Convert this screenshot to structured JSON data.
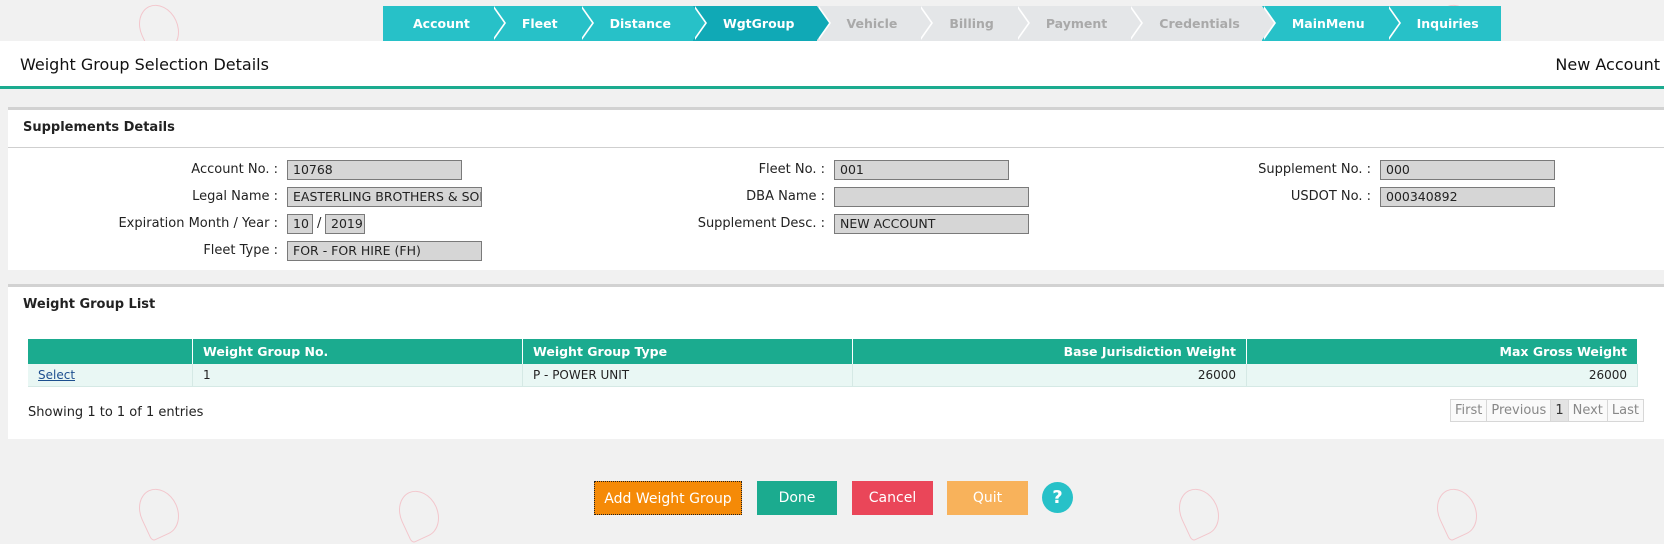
{
  "wizard": {
    "steps": [
      {
        "label": "Account",
        "state": "done"
      },
      {
        "label": "Fleet",
        "state": "done"
      },
      {
        "label": "Distance",
        "state": "done"
      },
      {
        "label": "WgtGroup",
        "state": "active"
      },
      {
        "label": "Vehicle",
        "state": "disabled"
      },
      {
        "label": "Billing",
        "state": "disabled"
      },
      {
        "label": "Payment",
        "state": "disabled"
      },
      {
        "label": "Credentials",
        "state": "disabled"
      },
      {
        "label": "MainMenu",
        "state": "done"
      },
      {
        "label": "Inquiries",
        "state": "done"
      }
    ]
  },
  "header": {
    "title": "Weight Group Selection Details",
    "right_text": "New Account"
  },
  "supplements": {
    "title": "Supplements Details",
    "account_no_label": "Account No. :",
    "account_no": "10768",
    "legal_name_label": "Legal Name :",
    "legal_name": "EASTERLING BROTHERS & SON",
    "expiration_label": "Expiration Month / Year :",
    "expiration_month": "10",
    "expiration_sep": "/",
    "expiration_year": "2019",
    "fleet_type_label": "Fleet Type :",
    "fleet_type": "FOR - FOR HIRE (FH)",
    "fleet_no_label": "Fleet No. :",
    "fleet_no": "001",
    "dba_name_label": "DBA Name :",
    "dba_name": "",
    "supp_desc_label": "Supplement Desc. :",
    "supp_desc": "NEW ACCOUNT",
    "supp_no_label": "Supplement No. :",
    "supp_no": "000",
    "usdot_label": "USDOT No. :",
    "usdot": "000340892"
  },
  "weight_groups": {
    "title": "Weight Group List",
    "columns": [
      "",
      "Weight Group No.",
      "Weight Group Type",
      "Base Jurisdiction Weight",
      "Max Gross Weight"
    ],
    "rows": [
      {
        "select": "Select",
        "no": "1",
        "type": "P - POWER UNIT",
        "base_weight": "26000",
        "max_weight": "26000"
      }
    ],
    "showing": "Showing 1 to 1 of 1 entries",
    "pager": {
      "first": "First",
      "previous": "Previous",
      "current": "1",
      "next": "Next",
      "last": "Last"
    }
  },
  "buttons": {
    "add": "Add Weight Group",
    "done": "Done",
    "cancel": "Cancel",
    "quit": "Quit",
    "help": "?"
  },
  "colors": {
    "teal": "#27c1c8",
    "green": "#1bab8f",
    "orange": "#f58a07",
    "red": "#ea4659",
    "light_orange": "#f8b25b"
  }
}
